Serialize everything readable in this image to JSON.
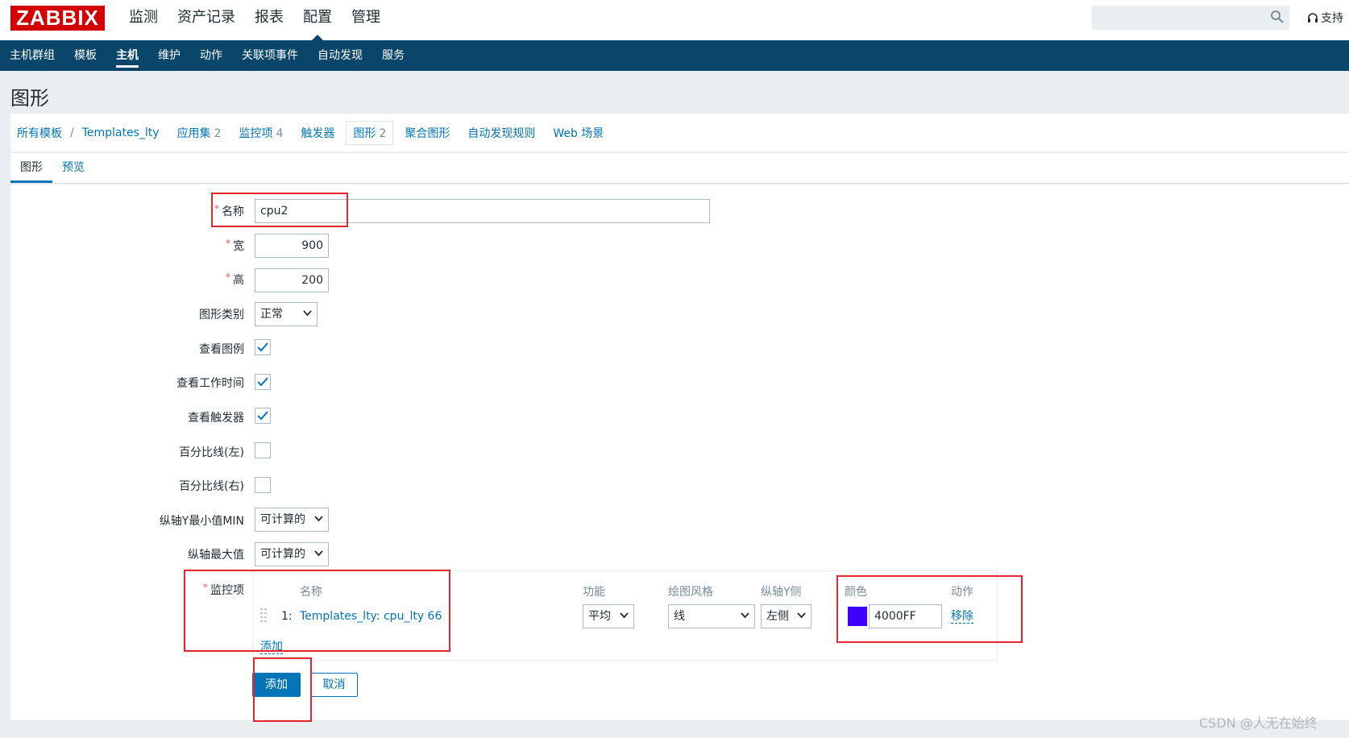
{
  "header": {
    "logo": "ZABBIX",
    "menu": [
      "监测",
      "资产记录",
      "报表",
      "配置",
      "管理"
    ],
    "active_menu_index": 3,
    "support": "支持",
    "icons": {
      "search": "search-icon",
      "support": "headset-icon"
    }
  },
  "submenu": {
    "items": [
      "主机群组",
      "模板",
      "主机",
      "维护",
      "动作",
      "关联项事件",
      "自动发现",
      "服务"
    ],
    "active_index": 2
  },
  "page": {
    "title": "图形"
  },
  "breadcrumb": {
    "root": "所有模板",
    "separator": "/",
    "template": "Templates_lty",
    "tabs": [
      {
        "label": "应用集",
        "count": "2"
      },
      {
        "label": "监控项",
        "count": "4"
      },
      {
        "label": "触发器",
        "count": ""
      },
      {
        "label": "图形",
        "count": "2"
      },
      {
        "label": "聚合图形",
        "count": ""
      },
      {
        "label": "自动发现规则",
        "count": ""
      },
      {
        "label": "Web 场景",
        "count": ""
      }
    ]
  },
  "form_tabs": {
    "graph": "图形",
    "preview": "预览"
  },
  "form": {
    "name_label": "名称",
    "name_value": "cpu2",
    "width_label": "宽",
    "width_value": "900",
    "height_label": "高",
    "height_value": "200",
    "type_label": "图形类别",
    "type_value": "正常",
    "show_legend_label": "查看图例",
    "show_legend": true,
    "show_work_period_label": "查看工作时间",
    "show_work_period": true,
    "show_triggers_label": "查看触发器",
    "show_triggers": true,
    "percentile_left_label": "百分比线(左)",
    "percentile_left": false,
    "percentile_right_label": "百分比线(右)",
    "percentile_right": false,
    "ymin_label": "纵轴Y最小值MIN",
    "ymin_value": "可计算的",
    "ymax_label": "纵轴最大值",
    "ymax_value": "可计算的",
    "items_label": "监控项",
    "items_columns": {
      "name": "名称",
      "function": "功能",
      "draw_style": "绘图风格",
      "y_axis": "纵轴Y侧",
      "color": "颜色",
      "action": "动作"
    },
    "items": [
      {
        "index": "1:",
        "name": "Templates_lty: cpu_lty 66",
        "function": "平均",
        "draw_style": "线",
        "y_axis": "左侧",
        "color_hex": "4000FF",
        "color": "#4000FF",
        "remove": "移除"
      }
    ],
    "add_item": "添加",
    "submit": "添加",
    "cancel": "取消"
  },
  "colors": {
    "brand_red": "#d40000",
    "nav_bg": "#0a466a",
    "link": "#0275b8",
    "highlight_box": "#e8252e"
  },
  "watermark": "CSDN @人无在始终"
}
